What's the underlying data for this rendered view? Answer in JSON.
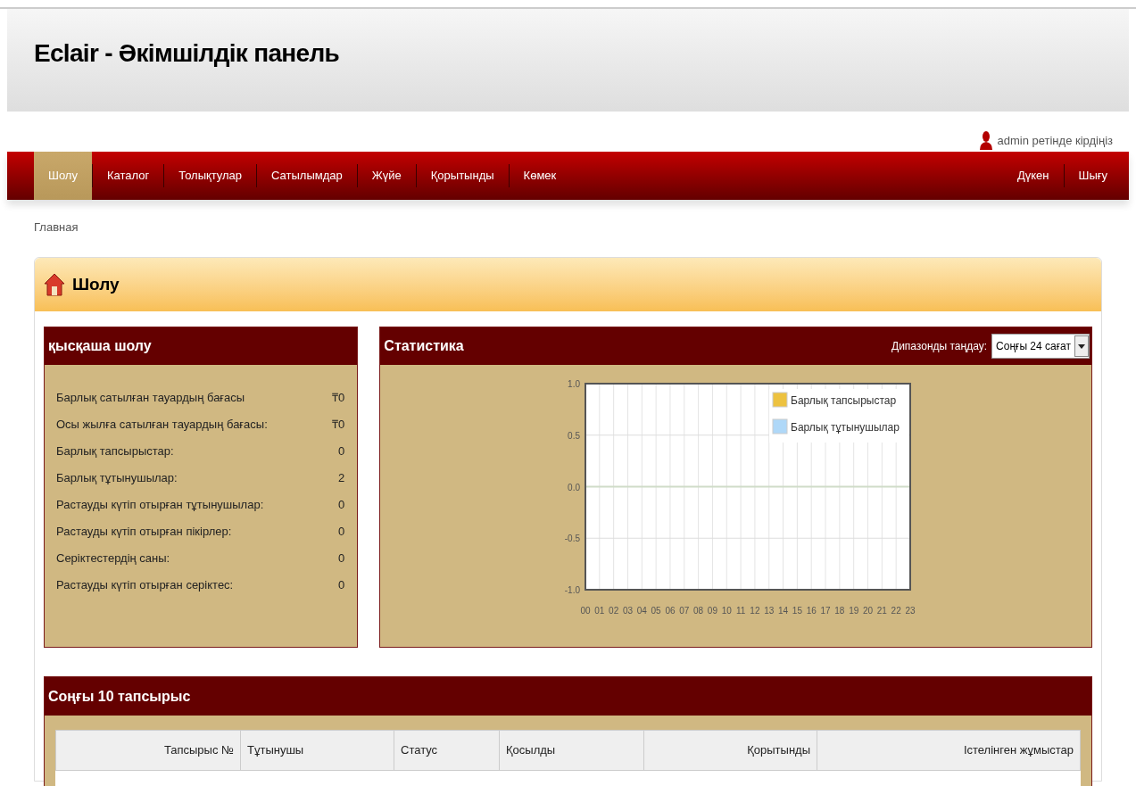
{
  "header": {
    "title": "Eclair - Әкімшілдік панель",
    "login_status": "admin ретінде кірдіңіз"
  },
  "nav": {
    "items": [
      {
        "label": "Шолу",
        "selected": true
      },
      {
        "label": "Каталог",
        "selected": false
      },
      {
        "label": "Толықтулар",
        "selected": false
      },
      {
        "label": "Сатылымдар",
        "selected": false
      },
      {
        "label": "Жүйе",
        "selected": false
      },
      {
        "label": "Қорытынды",
        "selected": false
      },
      {
        "label": "Көмек",
        "selected": false
      }
    ],
    "right_items": [
      {
        "label": "Дүкен"
      },
      {
        "label": "Шығу"
      }
    ]
  },
  "breadcrumb": "Главная",
  "page": {
    "title": "Шолу"
  },
  "summary": {
    "title": "қысқаша шолу",
    "rows": [
      {
        "label": "Барлық сатылған тауардың бағасы",
        "value": "₸0"
      },
      {
        "label": "Осы жылға сатылған тауардың бағасы:",
        "value": "₸0"
      },
      {
        "label": "Барлық тапсырыстар:",
        "value": "0"
      },
      {
        "label": "Барлық тұтынушылар:",
        "value": "2"
      },
      {
        "label": "Растауды күтіп отырған тұтынушылар:",
        "value": "0"
      },
      {
        "label": "Растауды күтіп отырған пікірлер:",
        "value": "0"
      },
      {
        "label": "Серіктестердің саны:",
        "value": "0"
      },
      {
        "label": "Растауды күтіп отырған серіктес:",
        "value": "0"
      }
    ]
  },
  "statistics": {
    "title": "Статистика",
    "range_label": "Дипазонды таңдау:",
    "range_value": "Соңғы 24 сағат",
    "chart_data": {
      "type": "line",
      "categories": [
        "00",
        "01",
        "02",
        "03",
        "04",
        "05",
        "06",
        "07",
        "08",
        "09",
        "10",
        "11",
        "12",
        "13",
        "14",
        "15",
        "16",
        "17",
        "18",
        "19",
        "20",
        "21",
        "22",
        "23"
      ],
      "series": [
        {
          "name": "Барлық тапсырыстар",
          "color": "#edc240",
          "values": [
            null,
            null,
            null,
            null,
            null,
            null,
            null,
            null,
            null,
            null,
            null,
            null,
            null,
            null,
            null,
            null,
            null,
            null,
            null,
            null,
            null,
            null,
            null,
            null
          ]
        },
        {
          "name": "Барлық тұтынушылар",
          "color": "#afd8f8",
          "values": [
            null,
            null,
            null,
            null,
            null,
            null,
            null,
            null,
            null,
            null,
            null,
            null,
            null,
            null,
            null,
            null,
            null,
            null,
            null,
            null,
            null,
            null,
            null,
            null
          ]
        }
      ],
      "grid": true,
      "ylim": [
        -1,
        1
      ],
      "yticks": [
        {
          "value": 1,
          "label": "1.0"
        },
        {
          "value": 0.5,
          "label": "0.5"
        },
        {
          "value": 0,
          "label": "0.0"
        },
        {
          "value": -0.5,
          "label": "-0.5"
        },
        {
          "value": -1,
          "label": "-1.0"
        }
      ]
    }
  },
  "orders": {
    "title": "Соңғы 10 тапсырыс",
    "columns": [
      "Тапсырыс №",
      "Тұтынушы",
      "Статус",
      "Қосылды",
      "Қорытынды",
      "Істелінген жұмыстар"
    ]
  }
}
